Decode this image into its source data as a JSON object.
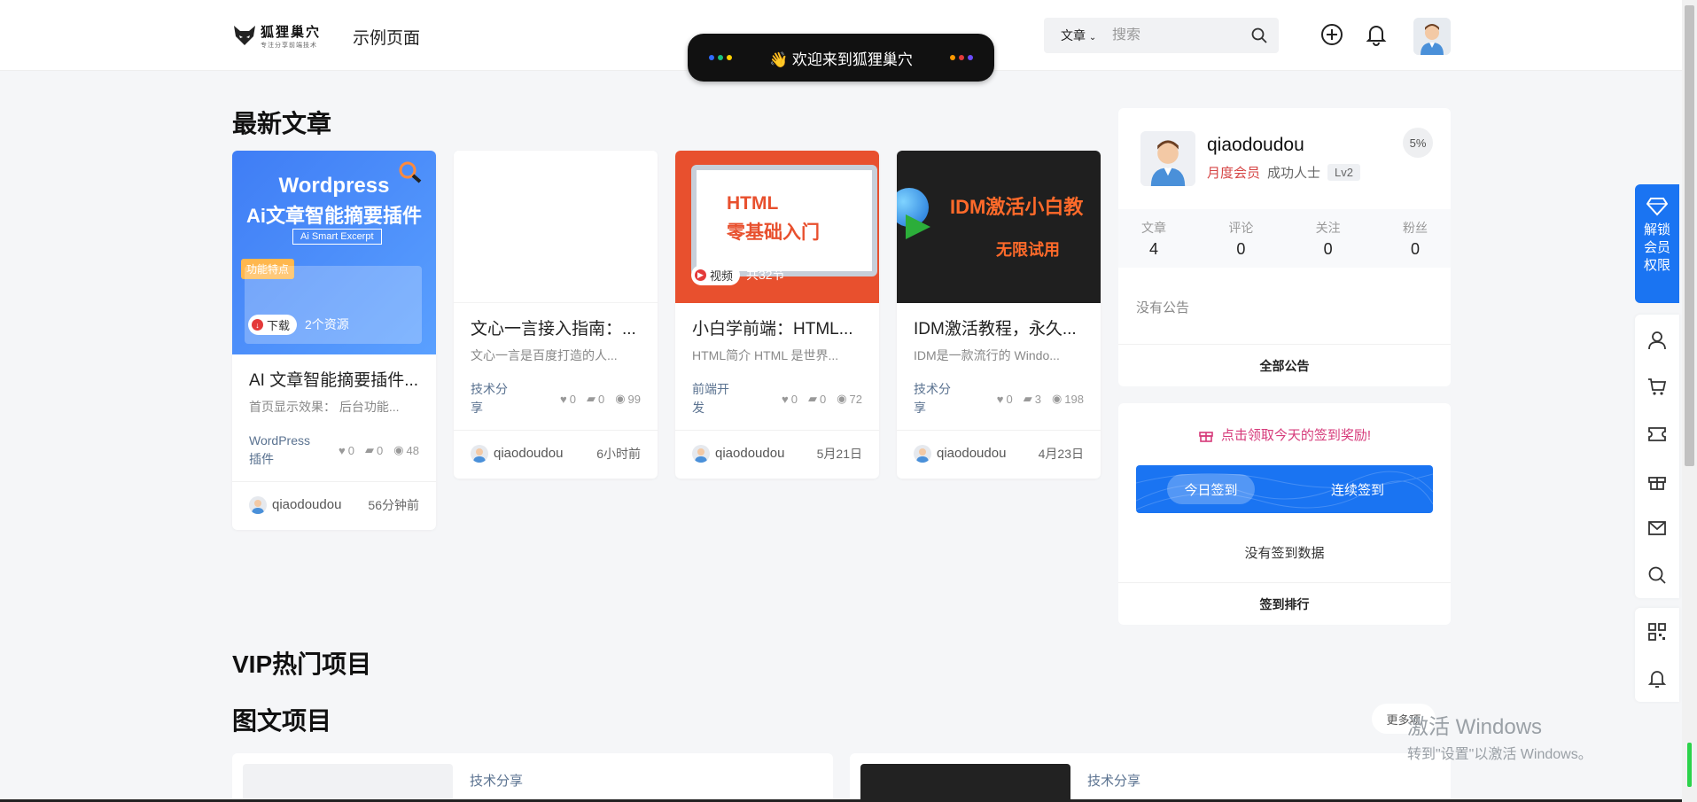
{
  "header": {
    "logo_text": "狐狸巢穴",
    "logo_sub": "专注分享前端技术",
    "nav_link": "示例页面",
    "welcome": "👋 欢迎来到狐狸巢穴",
    "search_type": "文章",
    "search_placeholder": "搜索"
  },
  "sections": {
    "latest": "最新文章",
    "vip_hot": "VIP热门项目",
    "graphic": "图文项目",
    "more": "更多项"
  },
  "cards": [
    {
      "title": "AI 文章智能摘要插件...",
      "excerpt": "首页显示效果： 后台功能...",
      "category": "WordPress插件",
      "likes": "0",
      "comments": "0",
      "views": "48",
      "author": "qiaodoudou",
      "time": "56分钟前",
      "badge": "下载",
      "badge_extra": "2个资源",
      "thumb_title": "Wordpress",
      "thumb_title2": "Ai文章智能摘要插件",
      "thumb_sub": "Ai Smart Excerpt",
      "thumb_feature": "功能特点"
    },
    {
      "title": "文心一言接入指南：...",
      "excerpt": "文心一言是百度打造的人...",
      "category": "技术分享",
      "likes": "0",
      "comments": "0",
      "views": "99",
      "author": "qiaodoudou",
      "time": "6小时前"
    },
    {
      "title": "小白学前端：HTML...",
      "excerpt": "HTML简介 HTML 是世界...",
      "category": "前端开发",
      "likes": "0",
      "comments": "0",
      "views": "72",
      "author": "qiaodoudou",
      "time": "5月21日",
      "badge": "视频",
      "badge_extra": "共32节",
      "thumb_title": "HTML",
      "thumb_title2": "零基础入门"
    },
    {
      "title": "IDM激活教程，永久...",
      "excerpt": "IDM是一款流行的 Windo...",
      "category": "技术分享",
      "likes": "0",
      "comments": "3",
      "views": "198",
      "author": "qiaodoudou",
      "time": "4月23日",
      "thumb_title": "IDM激活小白教",
      "thumb_title2": "无限试用"
    }
  ],
  "user": {
    "name": "qiaodoudou",
    "vip": "月度会员",
    "level_name": "成功人士",
    "level": "Lv2",
    "progress": "5%",
    "stats": [
      {
        "label": "文章",
        "value": "4"
      },
      {
        "label": "评论",
        "value": "0"
      },
      {
        "label": "关注",
        "value": "0"
      },
      {
        "label": "粉丝",
        "value": "0"
      }
    ],
    "notice": "没有公告",
    "all_notice": "全部公告"
  },
  "sign": {
    "tip": "点击领取今天的签到奖励!",
    "today": "今日签到",
    "continuous": "连续签到",
    "none": "没有签到数据",
    "rank": "签到排行"
  },
  "float": {
    "vip": "解锁会员权限"
  },
  "bottom_cards": [
    {
      "category": "技术分享"
    },
    {
      "category": "技术分享"
    }
  ],
  "windows": {
    "line1": "激活 Windows",
    "line2": "转到\"设置\"以激活 Windows。"
  },
  "colors": {
    "accent": "#1a74f2",
    "vip_red": "#d64545",
    "sign_pink": "#d63a7a"
  }
}
